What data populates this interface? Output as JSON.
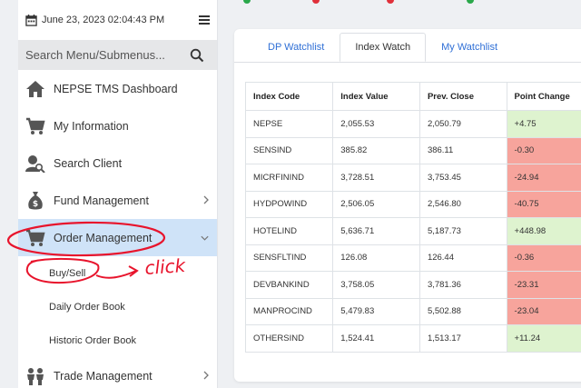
{
  "header": {
    "datetime": "June 23, 2023 02:04:43 PM"
  },
  "search": {
    "placeholder": "Search Menu/Submenus..."
  },
  "sidebar": {
    "items": [
      {
        "label": "NEPSE TMS Dashboard",
        "icon": "home-icon"
      },
      {
        "label": "My Information",
        "icon": "cart-icon"
      },
      {
        "label": "Search Client",
        "icon": "user-search-icon"
      },
      {
        "label": "Fund Management",
        "icon": "money-bag-icon"
      },
      {
        "label": "Order Management",
        "icon": "cart-icon"
      },
      {
        "label": "Trade Management",
        "icon": "people-icon"
      }
    ],
    "subitems": [
      "Buy/Sell",
      "Daily Order Book",
      "Historic Order Book"
    ]
  },
  "annotation": {
    "text": "click",
    "color": "#e8142c"
  },
  "tabs": [
    "DP Watchlist",
    "Index Watch",
    "My Watchlist"
  ],
  "table": {
    "headers": [
      "Index Code",
      "Index Value",
      "Prev. Close",
      "Point Change"
    ],
    "rows": [
      {
        "code": "NEPSE",
        "value": "2,055.53",
        "prev": "2,050.79",
        "change": "+4.75"
      },
      {
        "code": "SENSIND",
        "value": "385.82",
        "prev": "386.11",
        "change": "-0.30"
      },
      {
        "code": "MICRFININD",
        "value": "3,728.51",
        "prev": "3,753.45",
        "change": "-24.94"
      },
      {
        "code": "HYDPOWIND",
        "value": "2,506.05",
        "prev": "2,546.80",
        "change": "-40.75"
      },
      {
        "code": "HOTELIND",
        "value": "5,636.71",
        "prev": "5,187.73",
        "change": "+448.98"
      },
      {
        "code": "SENSFLTIND",
        "value": "126.08",
        "prev": "126.44",
        "change": "-0.36"
      },
      {
        "code": "DEVBANKIND",
        "value": "3,758.05",
        "prev": "3,781.36",
        "change": "-23.31"
      },
      {
        "code": "MANPROCIND",
        "value": "5,479.83",
        "prev": "5,502.88",
        "change": "-23.04"
      },
      {
        "code": "OTHERSIND",
        "value": "1,524.41",
        "prev": "1,513.17",
        "change": "+11.24"
      }
    ]
  },
  "colors": {
    "positive": "#def3cf",
    "negative": "#f7a49c",
    "active_menu": "#cfe3f8",
    "tab_link": "#2f6fd6"
  }
}
